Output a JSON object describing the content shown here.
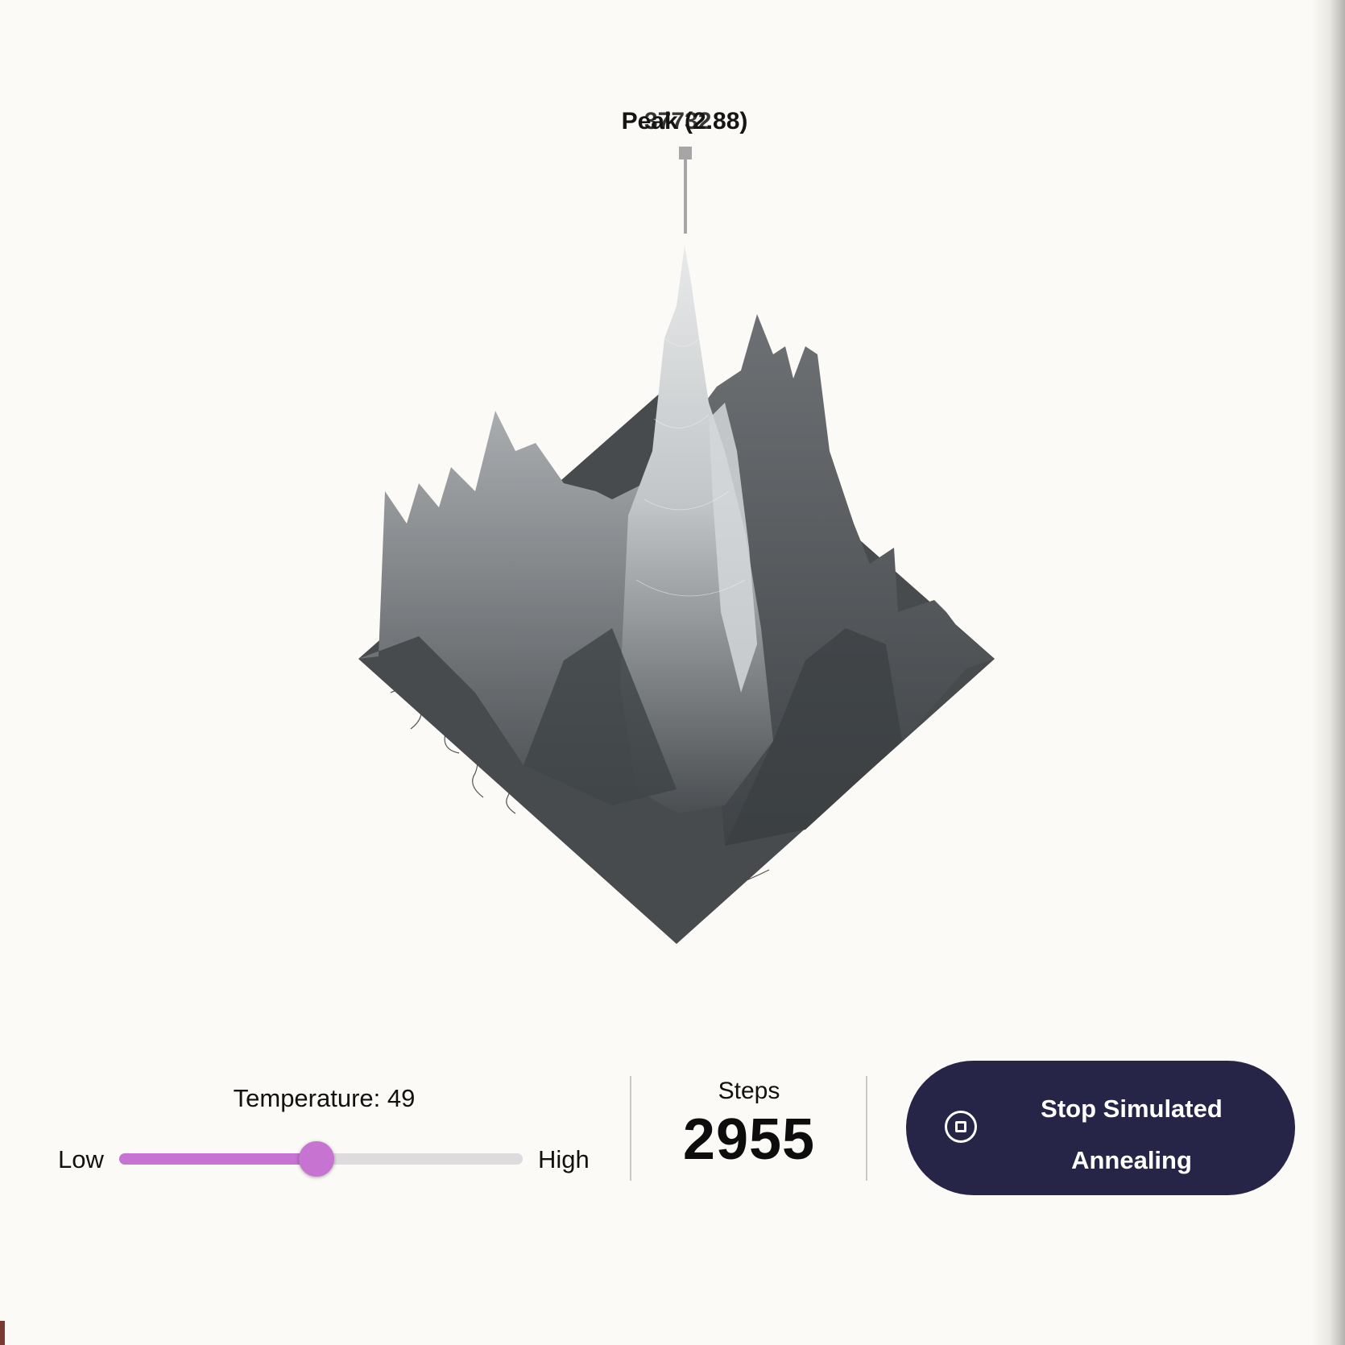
{
  "landscape": {
    "peak_label": "Peak (2.88)",
    "peak_label_overlay": "37732"
  },
  "temperature": {
    "title": "Temperature: 49",
    "value": 49,
    "low_label": "Low",
    "high_label": "High",
    "accent_color": "#c673d1"
  },
  "steps": {
    "label": "Steps",
    "value": "2955"
  },
  "stop_button": {
    "label": "Stop Simulated Annealing",
    "icon": "stop-circle-icon",
    "color": "#272547"
  }
}
